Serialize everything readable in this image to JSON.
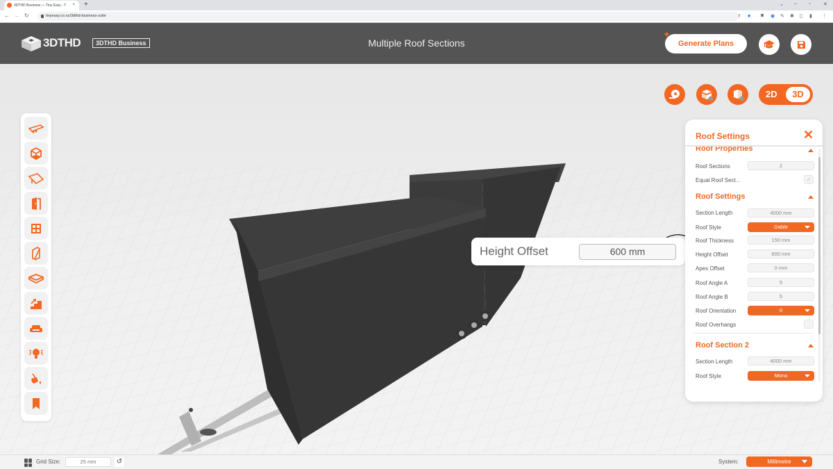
{
  "browser": {
    "tab_title": "3DTHD Business — Tiny Easy - T",
    "url": "tinyeasy.co.nz/3dthd-business-suite"
  },
  "header": {
    "logo_text": "3DTHD",
    "badge": "3DTHD Business",
    "title": "Multiple Roof Sections",
    "generate_label": "Generate Plans",
    "learn_icon": "graduation-cap-icon",
    "save_icon": "floppy-disk-icon"
  },
  "view_toolbar": {
    "tools": [
      {
        "name": "tape-measure",
        "icon": "tape-measure-icon"
      },
      {
        "name": "top-section-view",
        "icon": "box-section-icon"
      },
      {
        "name": "corner-view",
        "icon": "box-corner-icon"
      }
    ],
    "toggle": {
      "option_2d": "2D",
      "option_3d": "3D",
      "active": "3D"
    }
  },
  "left_toolbar": {
    "items": [
      {
        "name": "trailer",
        "icon": "trailer-icon"
      },
      {
        "name": "shell",
        "icon": "cube-icon"
      },
      {
        "name": "roof",
        "icon": "roof-icon"
      },
      {
        "name": "doors",
        "icon": "door-icon"
      },
      {
        "name": "windows",
        "icon": "window-icon"
      },
      {
        "name": "walls",
        "icon": "wall-panel-icon"
      },
      {
        "name": "floor",
        "icon": "floor-icon"
      },
      {
        "name": "stairs",
        "icon": "stairs-icon"
      },
      {
        "name": "furniture",
        "icon": "sofa-icon"
      },
      {
        "name": "lighting",
        "icon": "lightbulb-icon"
      },
      {
        "name": "paint",
        "icon": "paint-bucket-icon"
      },
      {
        "name": "bookmarks",
        "icon": "bookmark-icon"
      }
    ]
  },
  "panel": {
    "title": "Roof Settings",
    "sections": {
      "properties": {
        "title": "Roof Properties",
        "roof_sections_label": "Roof Sections",
        "roof_sections_value": "2",
        "equal_label": "Equal Roof Sect...",
        "equal_checked": true
      },
      "settings": {
        "title": "Roof Settings",
        "section_length_label": "Section Length",
        "section_length_value": "4000 mm",
        "roof_style_label": "Roof Style",
        "roof_style_value": "Gable",
        "thickness_label": "Roof Thickness",
        "thickness_value": "150 mm",
        "height_offset_label": "Height Offset",
        "height_offset_value": "600 mm",
        "apex_offset_label": "Apex Offset",
        "apex_offset_value": "0 mm",
        "angle_a_label": "Roof Angle A",
        "angle_a_value": "5",
        "angle_b_label": "Roof Angle B",
        "angle_b_value": "5",
        "orientation_label": "Roof Orientation",
        "orientation_value": "0",
        "overhangs_label": "Roof Overhangs",
        "overhangs_checked": false
      },
      "section2": {
        "title": "Roof Section 2",
        "section_length_label": "Section Length",
        "section_length_value": "4000 mm",
        "roof_style_label": "Roof Style",
        "roof_style_value": "Mono"
      }
    }
  },
  "callout": {
    "label": "Height Offset",
    "value": "600 mm"
  },
  "statusbar": {
    "grid_label": "Grid Size:",
    "grid_value": "25 mm",
    "system_label": "System:",
    "system_value": "Millimetre"
  },
  "colors": {
    "accent": "#f26722",
    "header_bg": "#545454",
    "model_dark": "#3a3a3a"
  }
}
